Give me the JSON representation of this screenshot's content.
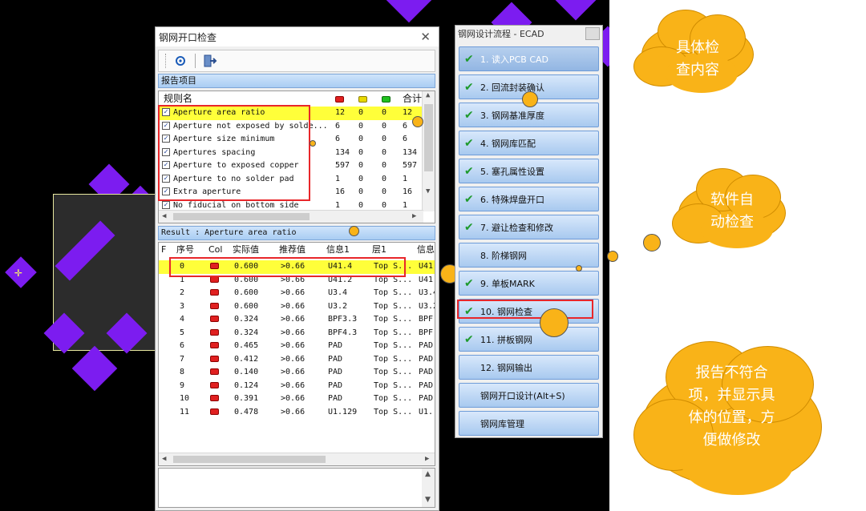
{
  "stencil_check_dialog": {
    "title": "钢网开口检查",
    "close_glyph": "✕",
    "toolbar": {
      "refresh_icon": "refresh-icon",
      "exit_icon": "exit-icon"
    },
    "report_section_label": "报告项目",
    "rules_columns": {
      "rule_name": "规则名",
      "total": "合计"
    },
    "rules": [
      {
        "checked": true,
        "name": "Aperture area ratio",
        "red": "12",
        "yellow": "0",
        "green": "0",
        "total": "12",
        "highlighted": true
      },
      {
        "checked": true,
        "name": "Aperture not exposed by solde...",
        "red": "6",
        "yellow": "0",
        "green": "0",
        "total": "6"
      },
      {
        "checked": true,
        "name": "Aperture size minimum",
        "red": "6",
        "yellow": "0",
        "green": "0",
        "total": "6"
      },
      {
        "checked": true,
        "name": "Apertures spacing",
        "red": "134",
        "yellow": "0",
        "green": "0",
        "total": "134"
      },
      {
        "checked": true,
        "name": "Aperture to exposed copper",
        "red": "597",
        "yellow": "0",
        "green": "0",
        "total": "597"
      },
      {
        "checked": true,
        "name": "Aperture to no solder pad",
        "red": "1",
        "yellow": "0",
        "green": "0",
        "total": "1"
      },
      {
        "checked": true,
        "name": "Extra aperture",
        "red": "16",
        "yellow": "0",
        "green": "0",
        "total": "16"
      },
      {
        "checked": true,
        "name": "No fiducial on bottom side",
        "red": "1",
        "yellow": "0",
        "green": "0",
        "total": "1"
      }
    ],
    "result_section_label": "Result : Aperture area ratio",
    "result_columns": {
      "f": "F",
      "index": "序号",
      "col": "Col",
      "actual": "实际值",
      "recommended": "推荐值",
      "info1": "信息1",
      "layer1": "层1",
      "info2": "信息"
    },
    "results": [
      {
        "index": "0",
        "actual": "0.600",
        "recommended": ">0.66",
        "info1": "U41.4",
        "layer1": "Top S...",
        "info2": "U41",
        "highlighted": true
      },
      {
        "index": "1",
        "actual": "0.600",
        "recommended": ">0.66",
        "info1": "U41.2",
        "layer1": "Top S...",
        "info2": "U41"
      },
      {
        "index": "2",
        "actual": "0.600",
        "recommended": ">0.66",
        "info1": "U3.4",
        "layer1": "Top S...",
        "info2": "U3.4"
      },
      {
        "index": "3",
        "actual": "0.600",
        "recommended": ">0.66",
        "info1": "U3.2",
        "layer1": "Top S...",
        "info2": "U3.2"
      },
      {
        "index": "4",
        "actual": "0.324",
        "recommended": ">0.66",
        "info1": "BPF3.3",
        "layer1": "Top S...",
        "info2": "BPF"
      },
      {
        "index": "5",
        "actual": "0.324",
        "recommended": ">0.66",
        "info1": "BPF4.3",
        "layer1": "Top S...",
        "info2": "BPF"
      },
      {
        "index": "6",
        "actual": "0.465",
        "recommended": ">0.66",
        "info1": "PAD",
        "layer1": "Top S...",
        "info2": "PAD"
      },
      {
        "index": "7",
        "actual": "0.412",
        "recommended": ">0.66",
        "info1": "PAD",
        "layer1": "Top S...",
        "info2": "PAD"
      },
      {
        "index": "8",
        "actual": "0.140",
        "recommended": ">0.66",
        "info1": "PAD",
        "layer1": "Top S...",
        "info2": "PAD"
      },
      {
        "index": "9",
        "actual": "0.124",
        "recommended": ">0.66",
        "info1": "PAD",
        "layer1": "Top S...",
        "info2": "PAD"
      },
      {
        "index": "10",
        "actual": "0.391",
        "recommended": ">0.66",
        "info1": "PAD",
        "layer1": "Top S...",
        "info2": "PAD"
      },
      {
        "index": "11",
        "actual": "0.478",
        "recommended": ">0.66",
        "info1": "U1.129",
        "layer1": "Top S...",
        "info2": "U1."
      }
    ]
  },
  "flow_dialog": {
    "title": "钢网设计流程 - ECAD",
    "steps": [
      {
        "label": "1. 读入PCB CAD",
        "done": true,
        "disabled": true
      },
      {
        "label": "2. 回流封装确认",
        "done": true
      },
      {
        "label": "3. 钢网基准厚度",
        "done": true
      },
      {
        "label": "4. 钢网库匹配",
        "done": true
      },
      {
        "label": "5. 塞孔属性设置",
        "done": true
      },
      {
        "label": "6. 特殊焊盘开口",
        "done": true
      },
      {
        "label": "7. 避让检查和修改",
        "done": true
      },
      {
        "label": "8. 阶梯钢网",
        "done": false
      },
      {
        "label": "9. 单板MARK",
        "done": true
      },
      {
        "label": "10. 钢网检查",
        "done": true
      },
      {
        "label": "11. 拼板钢网",
        "done": true
      },
      {
        "label": "12. 钢网输出",
        "done": false
      },
      {
        "label": "钢网开口设计(Alt+S)",
        "done": false
      },
      {
        "label": "钢网库管理",
        "done": false
      }
    ]
  },
  "annotations": {
    "cloud1": "具体检\n查内容",
    "cloud2": "软件自\n动检查",
    "cloud3": "报告不符合\n项，并显示具\n体的位置，方\n便做修改"
  },
  "colors": {
    "canvas": "#000000",
    "pad": "#7c1cf0",
    "highlight": "#ffff3a",
    "callout": "#f9b318",
    "red_box": "#e8262a",
    "sev_red": "#e02020",
    "sev_yellow": "#e8d800",
    "sev_green": "#20c020"
  }
}
